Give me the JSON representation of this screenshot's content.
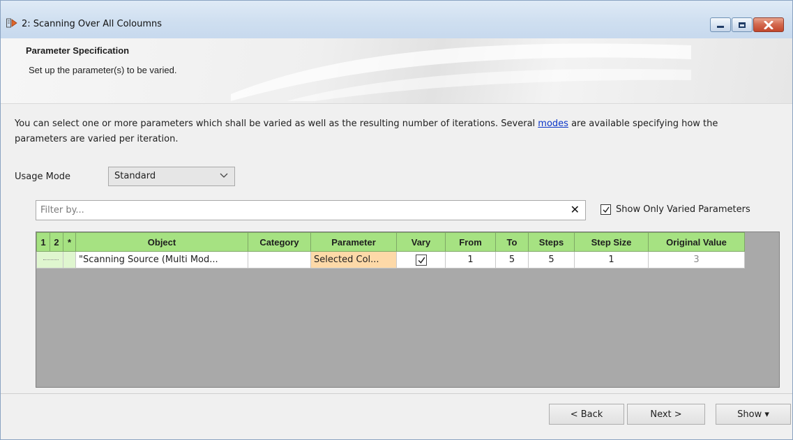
{
  "window": {
    "title": "2: Scanning Over All Coloumns",
    "buttons": [
      "minimize-icon",
      "maximize-icon",
      "close-icon"
    ]
  },
  "header": {
    "title": "Parameter Specification",
    "subtitle": "Set up the parameter(s) to be varied."
  },
  "description": {
    "text_before": "You can select one or more parameters which shall be varied as well as the resulting number of iterations. Several ",
    "link": "modes",
    "text_after": " are available specifying how the parameters are varied per iteration."
  },
  "usage_mode": {
    "label": "Usage Mode",
    "value": "Standard"
  },
  "filter": {
    "placeholder": "Filter by...",
    "clear_glyph": "✕"
  },
  "show_only_varied": {
    "label": "Show Only Varied Parameters",
    "checked": true
  },
  "table": {
    "headers": {
      "c1": "1",
      "c2": "2",
      "c3": "*",
      "object": "Object",
      "category": "Category",
      "parameter": "Parameter",
      "vary": "Vary",
      "from": "From",
      "to": "To",
      "steps": "Steps",
      "step_size": "Step Size",
      "original_value": "Original Value"
    },
    "rows": [
      {
        "object": "\"Scanning Source (Multi Mod...",
        "category": "",
        "parameter": "Selected Col...",
        "vary": true,
        "from": "1",
        "to": "5",
        "steps": "5",
        "step_size": "1",
        "original_value": "3"
      }
    ]
  },
  "footer": {
    "back": "< Back",
    "next": "Next >",
    "show": "Show ▾"
  },
  "colors": {
    "header_green": "#a6e282",
    "parameter_orange": "#fdd9a8",
    "link_blue": "#0b35c8",
    "close_red": "#c2462b"
  }
}
